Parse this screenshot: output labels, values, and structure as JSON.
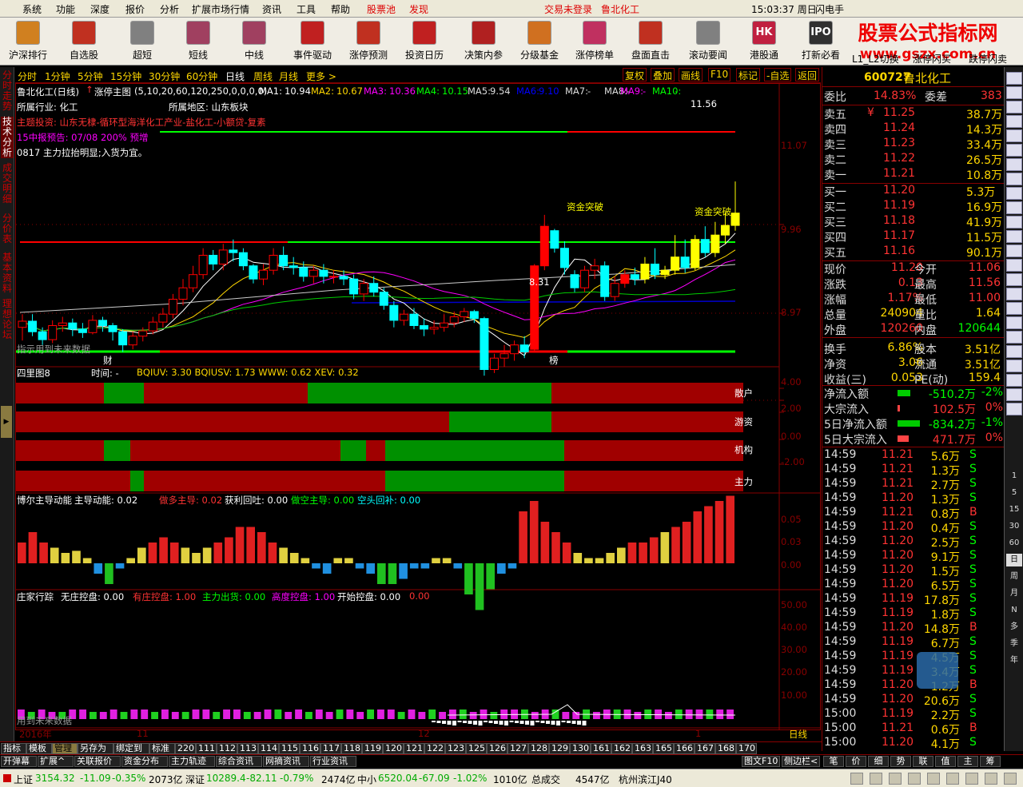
{
  "menu": {
    "items": [
      "系统",
      "功能",
      "深度",
      "报价",
      "分析",
      "扩展市场行情",
      "资讯",
      "工具",
      "帮助"
    ],
    "stockpool": "股票池",
    "discover": "发现",
    "login_status": "交易未登录",
    "current_stock": "鲁北化工",
    "time": "15:03:37 周日",
    "flash": "闪电手"
  },
  "toolbar": [
    {
      "label": "沪深排行",
      "icon": "bar-chart-icon",
      "color": "#d08020"
    },
    {
      "label": "自选股",
      "icon": "star-icon",
      "color": "#c03020"
    },
    {
      "label": "超短",
      "icon": "candle-chart-icon",
      "color": "#808080"
    },
    {
      "label": "短线",
      "icon": "candle-chart-icon",
      "color": "#a04060"
    },
    {
      "label": "中线",
      "icon": "candle-chart-icon",
      "color": "#a04060"
    },
    {
      "label": "事件驱动",
      "icon": "flame-icon",
      "color": "#c02020"
    },
    {
      "label": "涨停预测",
      "icon": "chart-question-icon",
      "color": "#c03020"
    },
    {
      "label": "投资日历",
      "icon": "calendar-icon",
      "color": "#c02020"
    },
    {
      "label": "决策内参",
      "icon": "flag-icon",
      "color": "#b02020"
    },
    {
      "label": "分级基金",
      "icon": "bell-icon",
      "color": "#d07020"
    },
    {
      "label": "涨停榜单",
      "icon": "trophy-icon",
      "color": "#c03060"
    },
    {
      "label": "盘面直击",
      "icon": "target-icon",
      "color": "#c03020"
    },
    {
      "label": "滚动要闻",
      "icon": "news-icon",
      "color": "#808080"
    },
    {
      "label": "港股通",
      "icon": "hk-icon",
      "color": "#c02040"
    },
    {
      "label": "打新必看",
      "icon": "ipo-icon",
      "color": "#303030"
    }
  ],
  "toolbar_text": [
    "L1_L2切换",
    "涨停闪买",
    "跌停闪卖"
  ],
  "brand": {
    "title": "股票公式指标网",
    "url": "www.gszx.com.cn"
  },
  "left_tabs": [
    "分时走势",
    "技术分析",
    "成交明细",
    "分价表",
    "基本资料",
    "理想论坛"
  ],
  "periods": [
    "分时",
    "1分钟",
    "5分钟",
    "15分钟",
    "30分钟",
    "60分钟",
    "日线",
    "周线",
    "月线",
    "更多 >"
  ],
  "period_right": [
    "复权",
    "叠加",
    "画线",
    "F10",
    "标记",
    "-自选",
    "返回"
  ],
  "chart_header": {
    "name": "鲁北化工(日线)",
    "indicator": "涨停主图",
    "params": "(5,10,20,60,120,250,0,0,0,0)",
    "ma": [
      {
        "n": "MA1:",
        "v": "10.94",
        "c": "#fff"
      },
      {
        "n": "MA2:",
        "v": "10.67",
        "c": "#ffd700"
      },
      {
        "n": "MA3:",
        "v": "10.36",
        "c": "#f0f"
      },
      {
        "n": "MA4:",
        "v": "10.15",
        "c": "#0f0"
      },
      {
        "n": "MA5:",
        "v": "9.54",
        "c": "#ddd"
      },
      {
        "n": "MA6:",
        "v": "9.10",
        "c": "#00f"
      },
      {
        "n": "MA7:",
        "v": "-",
        "c": "#ddd"
      },
      {
        "n": "MA8:",
        "v": "-",
        "c": "#ddd"
      },
      {
        "n": "MA9:",
        "v": "-",
        "c": "#f0f"
      },
      {
        "n": "MA10:",
        "v": "-",
        "c": "#0f0"
      }
    ]
  },
  "chart_info": {
    "industry": "所属行业: 化工",
    "region": "所属地区: 山东板块",
    "theme": "主题投资: 山东无棣-循环型海洋化工产业-盐化工-小额贷-复素",
    "forecast": "15中报预告: 07/08 200% 预增",
    "note": "0817 主力拉抬明显;入货为宜。",
    "future": "指示用到未来数据",
    "marker_cai": "财",
    "marker_bang": "榜",
    "breakout1": "资金突破",
    "breakout2": "资金突破",
    "high": "11.56",
    "low": "8.31"
  },
  "price_axis": [
    "11.07",
    "9.96",
    "8.97"
  ],
  "chart_data": [
    {
      "type": "candlestick",
      "title": "鲁北化工(日线)",
      "candles": [
        [
          9.9,
          9.97,
          9.75,
          10.05
        ],
        [
          9.97,
          9.85,
          9.8,
          10.05
        ],
        [
          9.85,
          9.76,
          9.7,
          9.9
        ],
        [
          9.76,
          9.92,
          9.72,
          9.98
        ],
        [
          9.92,
          9.95,
          9.85,
          10.02
        ],
        [
          9.95,
          9.88,
          9.8,
          10.0
        ],
        [
          9.88,
          9.84,
          9.78,
          9.95
        ],
        [
          9.84,
          9.98,
          9.82,
          10.04
        ],
        [
          9.98,
          9.92,
          9.85,
          10.02
        ],
        [
          9.92,
          9.85,
          9.75,
          9.95
        ],
        [
          9.85,
          9.7,
          9.62,
          9.88
        ],
        [
          9.7,
          9.8,
          9.65,
          9.85
        ],
        [
          9.8,
          9.86,
          9.74,
          9.9
        ],
        [
          9.86,
          9.96,
          9.82,
          10.02
        ],
        [
          9.96,
          10.05,
          9.9,
          10.12
        ],
        [
          10.05,
          10.22,
          10.0,
          10.28
        ],
        [
          10.22,
          10.35,
          10.15,
          10.45
        ],
        [
          10.35,
          10.5,
          10.3,
          10.6
        ],
        [
          10.5,
          10.72,
          10.45,
          10.8
        ],
        [
          10.72,
          10.62,
          10.55,
          10.78
        ],
        [
          10.62,
          10.78,
          10.55,
          10.85
        ],
        [
          10.78,
          10.75,
          10.65,
          10.9
        ],
        [
          10.75,
          10.6,
          10.55,
          10.8
        ],
        [
          10.6,
          10.45,
          10.4,
          10.62
        ],
        [
          10.45,
          10.55,
          10.38,
          10.62
        ],
        [
          10.55,
          10.72,
          10.5,
          10.8
        ],
        [
          10.72,
          10.6,
          10.55,
          10.82
        ],
        [
          10.6,
          10.58,
          10.5,
          10.7
        ],
        [
          10.58,
          10.48,
          10.42,
          10.65
        ],
        [
          10.48,
          10.55,
          10.4,
          10.6
        ],
        [
          10.55,
          10.48,
          10.4,
          10.62
        ],
        [
          10.48,
          10.48,
          10.4,
          10.55
        ],
        [
          10.48,
          10.45,
          10.38,
          10.55
        ],
        [
          10.45,
          10.28,
          10.22,
          10.5
        ],
        [
          10.28,
          10.4,
          10.2,
          10.45
        ],
        [
          10.4,
          10.3,
          10.25,
          10.48
        ],
        [
          10.3,
          10.15,
          10.1,
          10.35
        ],
        [
          10.15,
          9.98,
          9.9,
          10.2
        ],
        [
          9.98,
          10.05,
          9.92,
          10.1
        ],
        [
          10.05,
          9.92,
          9.88,
          10.12
        ],
        [
          9.92,
          9.88,
          9.8,
          10.0
        ],
        [
          9.88,
          9.9,
          9.82,
          9.98
        ],
        [
          9.9,
          9.95,
          9.85,
          10.05
        ],
        [
          9.95,
          10.02,
          9.9,
          10.08
        ],
        [
          10.02,
          10.08,
          9.96,
          10.12
        ],
        [
          10.08,
          10.0,
          9.95,
          10.1
        ],
        [
          10.0,
          9.42,
          9.35,
          10.02
        ],
        [
          9.42,
          9.55,
          9.38,
          9.6
        ],
        [
          9.55,
          9.6,
          9.45,
          9.7
        ],
        [
          9.6,
          9.7,
          9.52,
          9.75
        ],
        [
          9.7,
          9.62,
          9.55,
          9.8
        ],
        [
          9.65,
          10.6,
          9.62,
          10.62
        ],
        [
          10.6,
          11.05,
          10.55,
          11.18
        ],
        [
          11.0,
          10.8,
          10.75,
          11.02
        ],
        [
          10.8,
          10.58,
          10.5,
          10.88
        ],
        [
          10.5,
          10.35,
          10.3,
          10.55
        ],
        [
          10.35,
          10.55,
          10.3,
          10.6
        ],
        [
          10.55,
          10.6,
          10.45,
          10.68
        ],
        [
          10.6,
          10.25,
          10.2,
          10.65
        ],
        [
          10.25,
          10.4,
          10.2,
          10.48
        ],
        [
          10.4,
          10.5,
          10.35,
          10.55
        ],
        [
          10.5,
          10.45,
          10.38,
          10.58
        ],
        [
          10.45,
          10.62,
          10.4,
          10.7
        ],
        [
          10.62,
          10.5,
          10.45,
          10.8
        ],
        [
          10.5,
          10.55,
          10.45,
          10.6
        ],
        [
          10.55,
          10.7,
          10.5,
          10.95
        ],
        [
          10.7,
          10.58,
          10.52,
          10.9
        ],
        [
          10.58,
          10.9,
          10.55,
          10.95
        ],
        [
          10.9,
          10.75,
          10.7,
          11.05
        ],
        [
          10.75,
          10.95,
          10.7,
          11.1
        ],
        [
          10.95,
          11.06,
          10.85,
          11.2
        ],
        [
          11.06,
          11.2,
          11.0,
          11.56
        ]
      ]
    },
    {
      "type": "bar",
      "title": "四里图8",
      "series": [
        {
          "name": "散户",
          "values": [
            1
          ]
        },
        {
          "name": "游资",
          "values": [
            1
          ]
        },
        {
          "name": "机构",
          "values": [
            1
          ]
        },
        {
          "name": "主力",
          "values": [
            1
          ]
        }
      ],
      "header": "BQIUV: 3.30  BQIUSV: 1.73  WWW: 0.62  XEV: 0.32",
      "axis": [
        "4.00",
        "2.00",
        "0.00",
        "-2.00"
      ]
    },
    {
      "type": "bar",
      "title": "博尔主导动能",
      "values": [
        0.02,
        0.03,
        0.02,
        0.015,
        0.01,
        0.012,
        0.005,
        -0.01,
        -0.02,
        -0.005,
        0.005,
        0.015,
        0.02,
        0.025,
        0.02,
        0.015,
        0.01,
        0.015,
        0.02,
        0.025,
        0.035,
        0.035,
        0.03,
        0.02,
        0.015,
        0.01,
        0.005,
        -0.005,
        -0.01,
        0.005,
        0.005,
        -0.005,
        -0.01,
        -0.02,
        -0.02,
        -0.015,
        -0.005,
        -0.005,
        0.005,
        0.005,
        -0.005,
        -0.03,
        -0.045,
        -0.025,
        -0.01,
        -0.005,
        0.05,
        0.06,
        0.04,
        0.03,
        0.02,
        0.01,
        0.005,
        0.005,
        0.01,
        0.015,
        0.02,
        0.02,
        0.025,
        0.03,
        0.035,
        0.04,
        0.05,
        0.055,
        0.06,
        0.065
      ],
      "header": "主导动能: 0.02  做多主导: 0.02  获利回吐: 0.00  做空主导: 0.00  空头回补: 0.00",
      "axis": [
        "0.05",
        "0.03",
        "0.00"
      ]
    },
    {
      "type": "bar",
      "title": "庄家行踪",
      "values": [
        4,
        3,
        4,
        3,
        3,
        4,
        4,
        3,
        3,
        4,
        3,
        4,
        4,
        3,
        4,
        3,
        3,
        4,
        4,
        3,
        4,
        4,
        3,
        3,
        4,
        4,
        3,
        4,
        3,
        4,
        3,
        4,
        4,
        3,
        4,
        4,
        4,
        3,
        4,
        3,
        4,
        3,
        4,
        4,
        3,
        4,
        3,
        4,
        4,
        4,
        3,
        4,
        4,
        3,
        3,
        4,
        3,
        4,
        4,
        4,
        3,
        4,
        4,
        3,
        4,
        4,
        4,
        4,
        4,
        4
      ],
      "header": "无庄控盘: 0.00  有庄控盘: 1.00  主力出货: 0.00  高度控盘: 1.00  开始控盘: 0.00  0.00",
      "axis": [
        "50.00",
        "40.00",
        "30.00",
        "20.00",
        "10.00"
      ],
      "future": "用到未来数据"
    }
  ],
  "panels": {
    "p1_title": "四里图8",
    "p1_time": "时间: -",
    "p1_vals": "BQIUV: 3.30  BQIUSV: 1.73  WWW: 0.62  XEV: 0.32",
    "p1_rows": [
      "散户",
      "游资",
      "机构",
      "主力"
    ],
    "p2_title": "博尔主导动能",
    "p2_l1": "主导动能: 0.02",
    "p2_l2": "做多主导: 0.02",
    "p2_l3": "获利回吐: 0.00",
    "p2_l4": "做空主导: 0.00",
    "p2_l5": "空头回补: 0.00",
    "p3_title": "庄家行踪",
    "p3_l1": "无庄控盘: 0.00",
    "p3_l2": "有庄控盘: 1.00",
    "p3_l3": "主力出货: 0.00",
    "p3_l4": "高度控盘: 1.00",
    "p3_l5": "开始控盘: 0.00",
    "p3_l6": "0.00",
    "p3_future": "用到未来数据"
  },
  "date_axis": {
    "year": "2016年",
    "m11": "11",
    "m12": "12",
    "m1": "1",
    "period": "日线"
  },
  "quote": {
    "code": "600727",
    "name": "鲁北化工",
    "weibi_l": "委比",
    "weibi": "14.83%",
    "weicha_l": "委差",
    "weicha": "383",
    "asks": [
      [
        "卖五",
        "¥",
        "11.25",
        "38.7万"
      ],
      [
        "卖四",
        "",
        "11.24",
        "14.3万"
      ],
      [
        "卖三",
        "",
        "11.23",
        "33.4万"
      ],
      [
        "卖二",
        "",
        "11.22",
        "26.5万"
      ],
      [
        "卖一",
        "",
        "11.21",
        "10.8万"
      ]
    ],
    "bids": [
      [
        "买一",
        "11.20",
        "5.3万"
      ],
      [
        "买二",
        "11.19",
        "16.9万"
      ],
      [
        "买三",
        "11.18",
        "41.9万"
      ],
      [
        "买四",
        "11.17",
        "11.5万"
      ],
      [
        "买五",
        "11.16",
        "90.1万"
      ]
    ],
    "stats": [
      [
        "现价",
        "11.20",
        "今开",
        "11.06"
      ],
      [
        "涨跌",
        "0.13",
        "最高",
        "11.56"
      ],
      [
        "涨幅",
        "1.17%",
        "最低",
        "11.00"
      ],
      [
        "总量",
        "240904",
        "量比",
        "1.64"
      ],
      [
        "外盘",
        "120260",
        "内盘",
        "120644"
      ],
      [
        "换手",
        "6.86%",
        "股本",
        "3.51亿"
      ],
      [
        "净资",
        "3.06",
        "流通",
        "3.51亿"
      ],
      [
        "收益(三)",
        "0.053",
        "PE(动)",
        "159.4"
      ]
    ],
    "flows": [
      [
        "净流入额",
        "-510.2万",
        "-2%"
      ],
      [
        "大宗流入",
        "102.5万",
        "0%"
      ],
      [
        "5日净流入额",
        "-834.2万",
        "-1%"
      ],
      [
        "5日大宗流入",
        "471.7万",
        "0%"
      ]
    ],
    "ticks": [
      [
        "14:59",
        "11.21",
        "5.6万",
        "S"
      ],
      [
        "14:59",
        "11.21",
        "1.3万",
        "S"
      ],
      [
        "14:59",
        "11.21",
        "2.7万",
        "S"
      ],
      [
        "14:59",
        "11.20",
        "1.3万",
        "S"
      ],
      [
        "14:59",
        "11.21",
        "0.8万",
        "B"
      ],
      [
        "14:59",
        "11.20",
        "0.4万",
        "S"
      ],
      [
        "14:59",
        "11.20",
        "2.5万",
        "S"
      ],
      [
        "14:59",
        "11.20",
        "9.1万",
        "S"
      ],
      [
        "14:59",
        "11.20",
        "1.5万",
        "S"
      ],
      [
        "14:59",
        "11.20",
        "6.5万",
        "S"
      ],
      [
        "14:59",
        "11.19",
        "17.8万",
        "S"
      ],
      [
        "14:59",
        "11.19",
        "1.8万",
        "S"
      ],
      [
        "14:59",
        "11.20",
        "14.8万",
        "B"
      ],
      [
        "14:59",
        "11.19",
        "6.7万",
        "S"
      ],
      [
        "14:59",
        "11.19",
        "4.5万",
        "S"
      ],
      [
        "14:59",
        "11.19",
        "3.4万",
        "S"
      ],
      [
        "14:59",
        "11.20",
        "1.2万",
        "B"
      ],
      [
        "14:59",
        "11.20",
        "20.6万",
        "S"
      ],
      [
        "15:00",
        "11.19",
        "2.2万",
        "S"
      ],
      [
        "15:00",
        "11.21",
        "0.6万",
        "B"
      ],
      [
        "15:00",
        "11.20",
        "4.1万",
        "S"
      ]
    ]
  },
  "right_strip": [
    "1",
    "5",
    "15",
    "30",
    "60",
    "日",
    "周",
    "月",
    "N",
    "多",
    "季",
    "年"
  ],
  "bottom_tabs": [
    "指标",
    "模板",
    "管理",
    "另存为",
    "绑定到",
    "标准",
    "220",
    "111",
    "112",
    "113",
    "114",
    "115",
    "116",
    "117",
    "118",
    "119",
    "120",
    "121",
    "122",
    "123",
    "125",
    "126",
    "127",
    "128",
    "129",
    "130",
    "161",
    "162",
    "163",
    "165",
    "166",
    "167",
    "168",
    "170"
  ],
  "func_tabs": [
    "开弹幕",
    "扩展^",
    "关联报价",
    "资金分布",
    "主力轨迹",
    "综合资讯",
    "网摘资讯",
    "行业资讯"
  ],
  "func_right": [
    "图文F10",
    "侧边栏<"
  ],
  "func_quote": [
    "笔",
    "价",
    "细",
    "势",
    "联",
    "值",
    "主",
    "筹"
  ],
  "status": {
    "sh": "上证",
    "sh_v": "3154.32",
    "sh_c": "-11.09",
    "sh_p": "-0.35%",
    "sh_a": "2073亿",
    "sz": "深证",
    "sz_v": "10289.4",
    "sz_c": "-82.11",
    "sz_p": "-0.79%",
    "sz_a": "2474亿",
    "zx": "中小",
    "zx_v": "6520.04",
    "zx_c": "-67.09",
    "zx_p": "-1.02%",
    "zx_a": "1010亿",
    "total": "总成交",
    "total_v": "4547亿",
    "loc": "杭州滨江J40"
  }
}
